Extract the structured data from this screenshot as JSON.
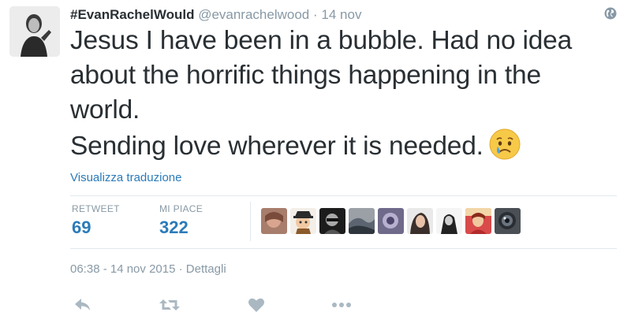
{
  "user": {
    "display_name": "#EvanRachelWould",
    "screen_name": "@evanrachelwood",
    "separator": "·",
    "time": "14 nov"
  },
  "tweet": {
    "lines": [
      "Jesus I have been in a bubble. Had no idea",
      "about the horrific things happening in the",
      "world.",
      "Sending love wherever it is needed."
    ],
    "emoji": "crying-face"
  },
  "translate_link": "Visualizza traduzione",
  "stats": {
    "retweet_label": "RETWEET",
    "retweet_count": "69",
    "like_label": "MI PIACE",
    "like_count": "322"
  },
  "liker_avatars": [
    "avatar-1",
    "avatar-2",
    "avatar-3",
    "avatar-4",
    "avatar-5",
    "avatar-6",
    "avatar-7",
    "avatar-8",
    "avatar-9"
  ],
  "meta": {
    "timestamp": "06:38 - 14 nov 2015",
    "separator": "·",
    "details_link": "Dettagli"
  },
  "icons": {
    "reply": "reply-icon",
    "retweet": "retweet-icon",
    "like": "heart-icon",
    "more": "more-icon",
    "globe": "globe-icon"
  },
  "colors": {
    "link_blue": "#2b7bb9",
    "muted_gray": "#8899a6",
    "text": "#292f33",
    "icon_gray": "#aab8c2"
  }
}
